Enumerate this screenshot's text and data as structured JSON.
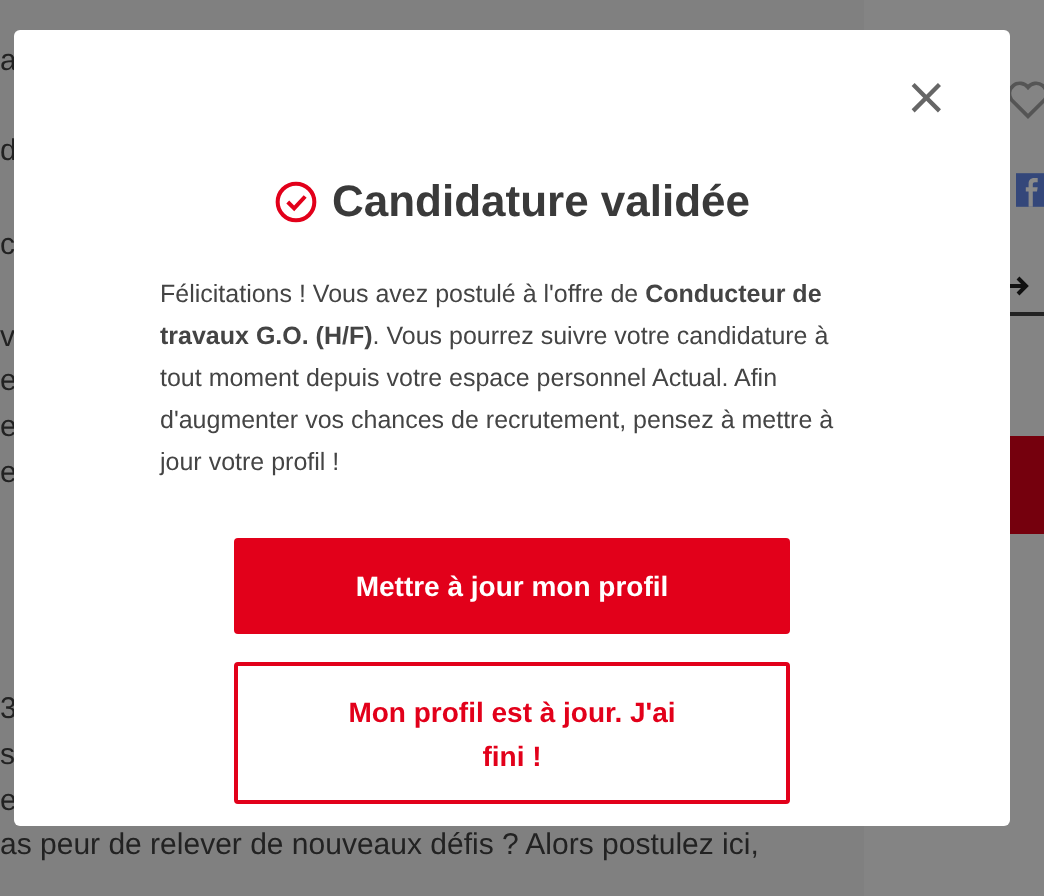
{
  "background_page": {
    "left_fragments": [
      "a",
      "d",
      "c",
      "v",
      "e",
      "e",
      "e",
      "3",
      "s",
      "e"
    ],
    "bottom_line": "as peur de relever de nouveaux défis ? Alors postulez ici,"
  },
  "modal": {
    "close": "×",
    "title": "Candidature validée",
    "message": "Félicitations ! Vous avez postulé à l'offre de **Conducteur de travaux G.O. (H/F)**. Vous pourrez suivre votre candidature à tout moment depuis votre espace personnel Actual. Afin d'augmenter vos chances de recrutement, pensez à mettre à jour votre profil !",
    "buttons": [
      {
        "label": "Mettre à jour mon profil",
        "kind": "primary"
      },
      {
        "label": "Mon profil est à jour. J'ai fini !",
        "kind": "outline"
      }
    ]
  }
}
